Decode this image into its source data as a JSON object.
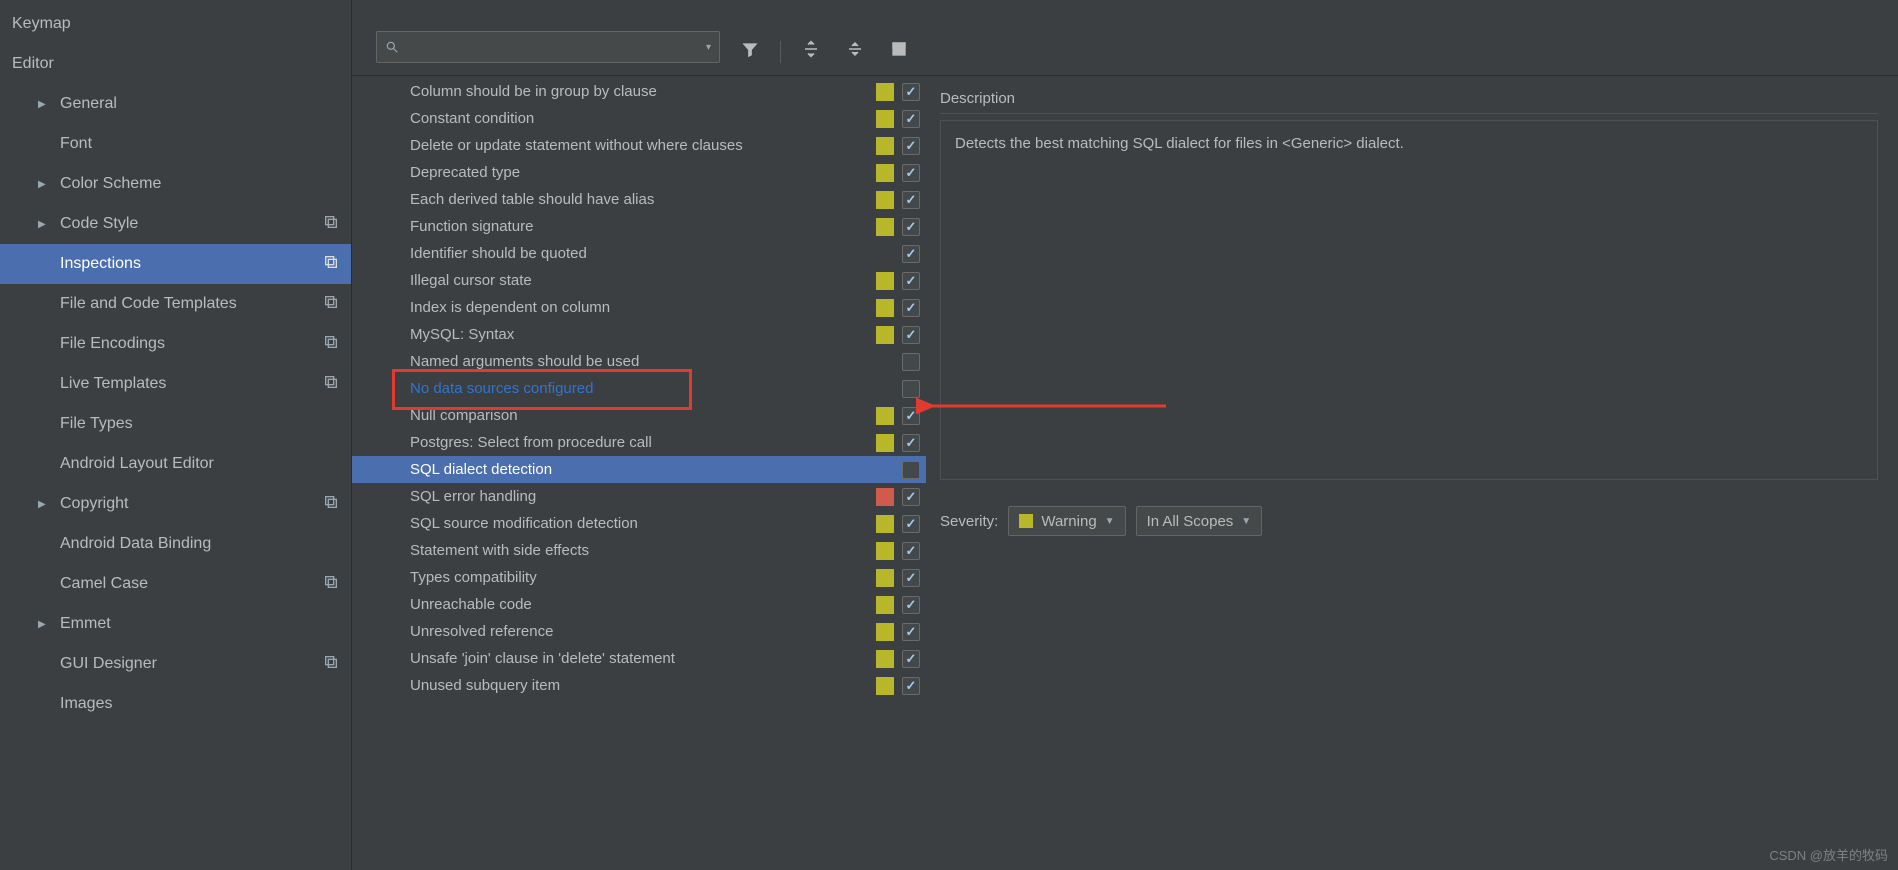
{
  "sidebar": {
    "keymap": "Keymap",
    "editor": "Editor",
    "items": [
      {
        "label": "General",
        "arrow": true,
        "copy": false
      },
      {
        "label": "Font",
        "arrow": false,
        "copy": false
      },
      {
        "label": "Color Scheme",
        "arrow": true,
        "copy": false
      },
      {
        "label": "Code Style",
        "arrow": true,
        "copy": true
      },
      {
        "label": "Inspections",
        "arrow": false,
        "copy": true,
        "selected": true
      },
      {
        "label": "File and Code Templates",
        "arrow": false,
        "copy": true
      },
      {
        "label": "File Encodings",
        "arrow": false,
        "copy": true
      },
      {
        "label": "Live Templates",
        "arrow": false,
        "copy": true
      },
      {
        "label": "File Types",
        "arrow": false,
        "copy": false
      },
      {
        "label": "Android Layout Editor",
        "arrow": false,
        "copy": false
      },
      {
        "label": "Copyright",
        "arrow": true,
        "copy": true
      },
      {
        "label": "Android Data Binding",
        "arrow": false,
        "copy": false
      },
      {
        "label": "Camel Case",
        "arrow": false,
        "copy": true
      },
      {
        "label": "Emmet",
        "arrow": true,
        "copy": false
      },
      {
        "label": "GUI Designer",
        "arrow": false,
        "copy": true
      },
      {
        "label": "Images",
        "arrow": false,
        "copy": false
      }
    ]
  },
  "search": {
    "placeholder": ""
  },
  "inspections": [
    {
      "label": "Column should be in group by clause",
      "sev": "warning",
      "checked": true
    },
    {
      "label": "Constant condition",
      "sev": "warning",
      "checked": true
    },
    {
      "label": "Delete or update statement without where clauses",
      "sev": "warning",
      "checked": true
    },
    {
      "label": "Deprecated type",
      "sev": "warning",
      "checked": true
    },
    {
      "label": "Each derived table should have alias",
      "sev": "warning",
      "checked": true
    },
    {
      "label": "Function signature",
      "sev": "warning",
      "checked": true
    },
    {
      "label": "Identifier should be quoted",
      "sev": "",
      "checked": true
    },
    {
      "label": "Illegal cursor state",
      "sev": "warning",
      "checked": true
    },
    {
      "label": "Index is dependent on column",
      "sev": "warning",
      "checked": true
    },
    {
      "label": "MySQL: Syntax",
      "sev": "warning",
      "checked": true
    },
    {
      "label": "Named arguments should be used",
      "sev": "",
      "checked": false
    },
    {
      "label": "No data sources configured",
      "sev": "",
      "checked": false,
      "highlighted": true
    },
    {
      "label": "Null comparison",
      "sev": "warning",
      "checked": true
    },
    {
      "label": "Postgres: Select from procedure call",
      "sev": "warning",
      "checked": true
    },
    {
      "label": "SQL dialect detection",
      "sev": "",
      "checked": false,
      "selected": true
    },
    {
      "label": "SQL error handling",
      "sev": "error",
      "checked": true
    },
    {
      "label": "SQL source modification detection",
      "sev": "warning",
      "checked": true
    },
    {
      "label": "Statement with side effects",
      "sev": "warning",
      "checked": true
    },
    {
      "label": "Types compatibility",
      "sev": "warning",
      "checked": true
    },
    {
      "label": "Unreachable code",
      "sev": "warning",
      "checked": true
    },
    {
      "label": "Unresolved reference",
      "sev": "warning",
      "checked": true
    },
    {
      "label": "Unsafe 'join' clause in 'delete' statement",
      "sev": "warning",
      "checked": true
    },
    {
      "label": "Unused subquery item",
      "sev": "warning",
      "checked": true
    }
  ],
  "description": {
    "title": "Description",
    "body": "Detects the best matching SQL dialect for files in <Generic> dialect."
  },
  "severity": {
    "label": "Severity:",
    "value": "Warning",
    "scope": "In All Scopes"
  },
  "watermark": "CSDN @放羊的牧码"
}
